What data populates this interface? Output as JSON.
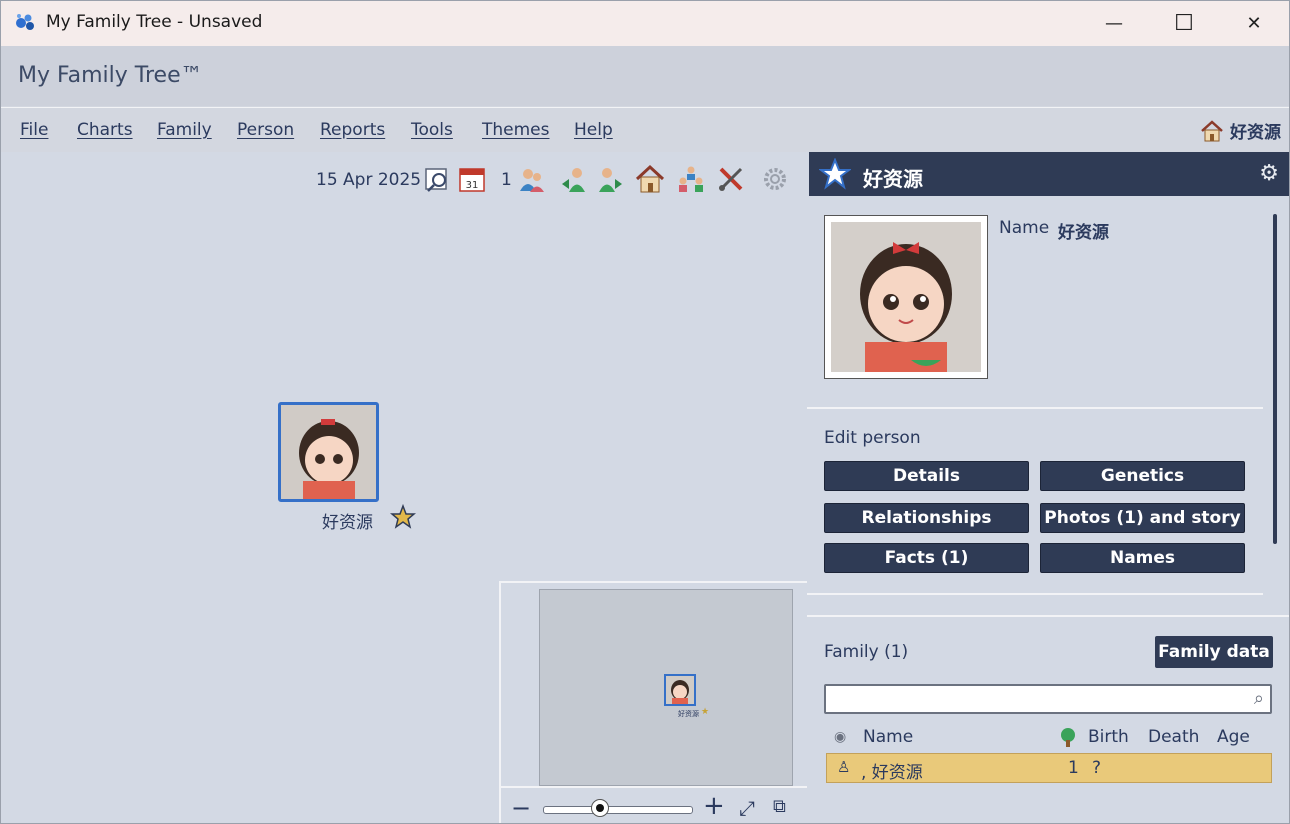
{
  "window": {
    "title": "My Family Tree - Unsaved",
    "minimize": "—",
    "maximize": "☐",
    "close": "✕"
  },
  "app": {
    "name": "My Family Tree™"
  },
  "menu": {
    "items": [
      "File",
      "Charts",
      "Family",
      "Person",
      "Reports",
      "Tools",
      "Themes",
      "Help"
    ],
    "home_person": "好资源"
  },
  "toolbar": {
    "date": "15 Apr 2025",
    "count": "1"
  },
  "canvas": {
    "person_name": "好资源"
  },
  "minimap": {
    "person_name": "好资源",
    "zoom_level": 0.38
  },
  "panel": {
    "header_name": "好资源",
    "name_label": "Name",
    "name_value": "好资源",
    "edit_title": "Edit person",
    "buttons": {
      "details": "Details",
      "genetics": "Genetics",
      "relationships": "Relationships",
      "photos": "Photos (1) and story",
      "facts": "Facts (1)",
      "names": "Names"
    },
    "family_title": "Family (1)",
    "family_data": "Family data",
    "search_value": "",
    "columns": {
      "name": "Name",
      "birth": "Birth",
      "death": "Death",
      "age": "Age"
    },
    "rows": [
      {
        "name": ", 好资源",
        "birth": "1",
        "death": "?",
        "age": ""
      }
    ]
  },
  "colors": {
    "accent": "#2f3b55",
    "selection": "#e9c97a",
    "card_border": "#3570c8"
  }
}
